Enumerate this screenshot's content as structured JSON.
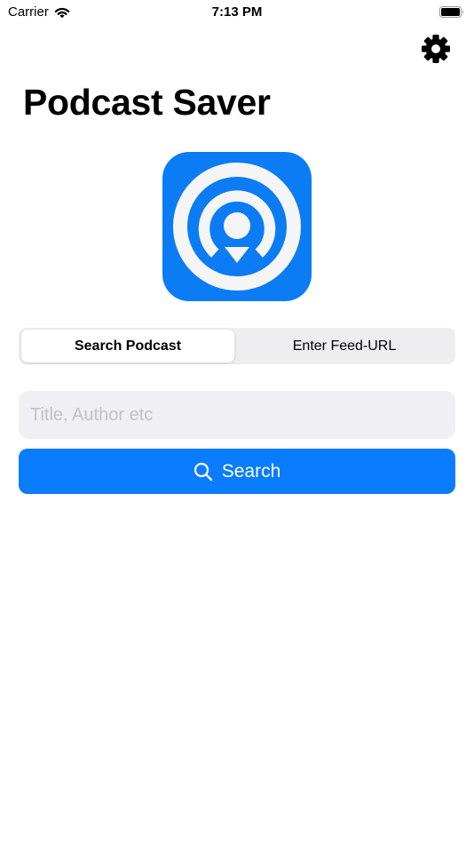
{
  "status_bar": {
    "carrier": "Carrier",
    "time": "7:13 PM"
  },
  "header": {
    "title": "Podcast Saver",
    "settings_icon": "gear-icon"
  },
  "logo": {
    "icon": "podcast-download-icon",
    "background_color": "#0b7cf3"
  },
  "segmented_control": {
    "segments": [
      {
        "label": "Search Podcast",
        "selected": true
      },
      {
        "label": "Enter Feed-URL",
        "selected": false
      }
    ]
  },
  "search": {
    "value": "",
    "placeholder": "Title, Author etc",
    "button_label": "Search",
    "button_icon": "search-icon"
  },
  "colors": {
    "accent": "#0a7cff",
    "field_background": "#f0f0f4",
    "segment_background": "#eeeef0",
    "placeholder": "#c1c1c6"
  }
}
